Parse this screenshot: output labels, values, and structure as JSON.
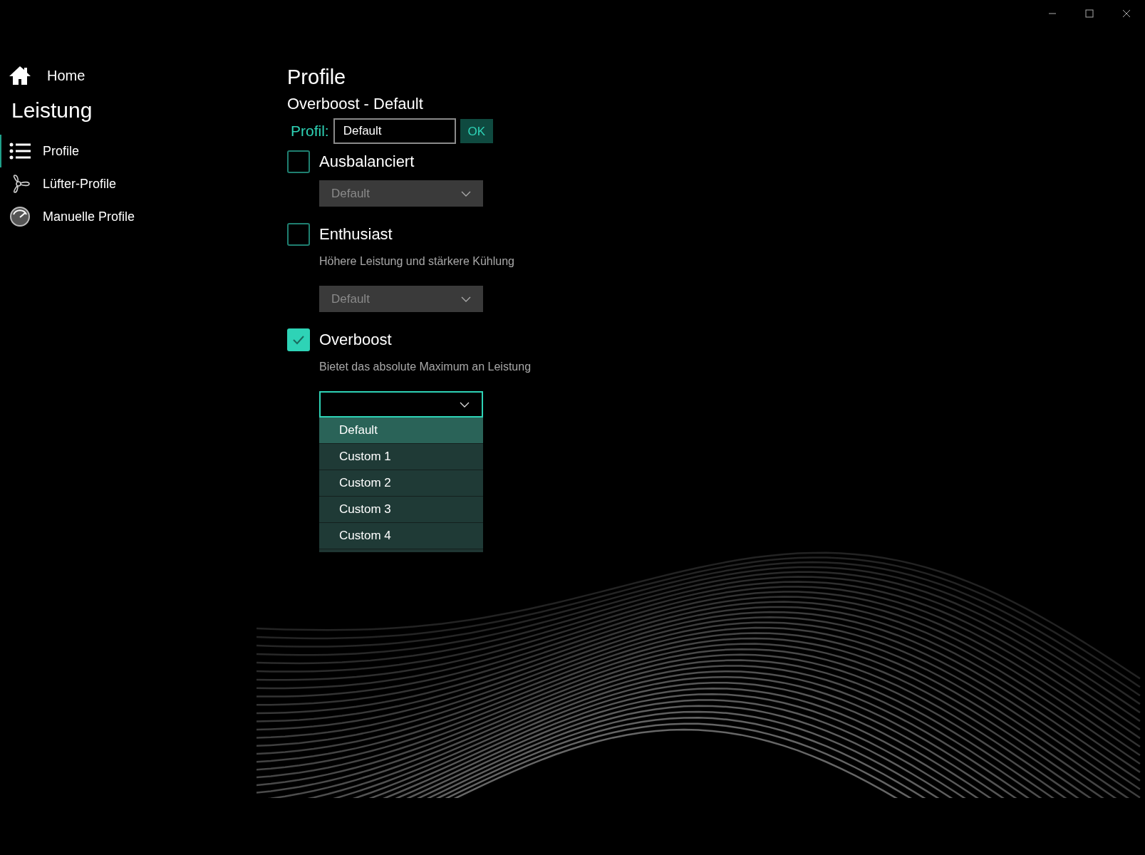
{
  "sidebar": {
    "home": {
      "label": "Home"
    },
    "section_title": "Leistung",
    "items": [
      {
        "label": "Profile",
        "kind": "list",
        "selected": true
      },
      {
        "label": "Lüfter-Profile",
        "kind": "fan",
        "selected": false
      },
      {
        "label": "Manuelle Profile",
        "kind": "gauge",
        "selected": false
      }
    ]
  },
  "main": {
    "title": "Profile",
    "subtitle": "Overboost - Default",
    "profile_field": {
      "label": "Profil:",
      "value": "Default"
    },
    "ok_button": "OK",
    "options": [
      {
        "label": "Ausbalanciert",
        "checked": false,
        "dropdown": {
          "value": "Default",
          "disabled": true,
          "expanded": false
        }
      },
      {
        "label": "Enthusiast",
        "checked": false,
        "description": "Höhere Leistung und stärkere Kühlung",
        "dropdown": {
          "value": "Default",
          "disabled": true,
          "expanded": false
        }
      },
      {
        "label": "Overboost",
        "checked": true,
        "description": "Bietet das absolute Maximum an Leistung",
        "dropdown": {
          "disabled": false,
          "expanded": true,
          "items": [
            {
              "label": "Default",
              "selected": true
            },
            {
              "label": "Custom 1",
              "selected": false
            },
            {
              "label": "Custom 2",
              "selected": false
            },
            {
              "label": "Custom 3",
              "selected": false
            },
            {
              "label": "Custom 4",
              "selected": false
            }
          ]
        }
      }
    ]
  }
}
